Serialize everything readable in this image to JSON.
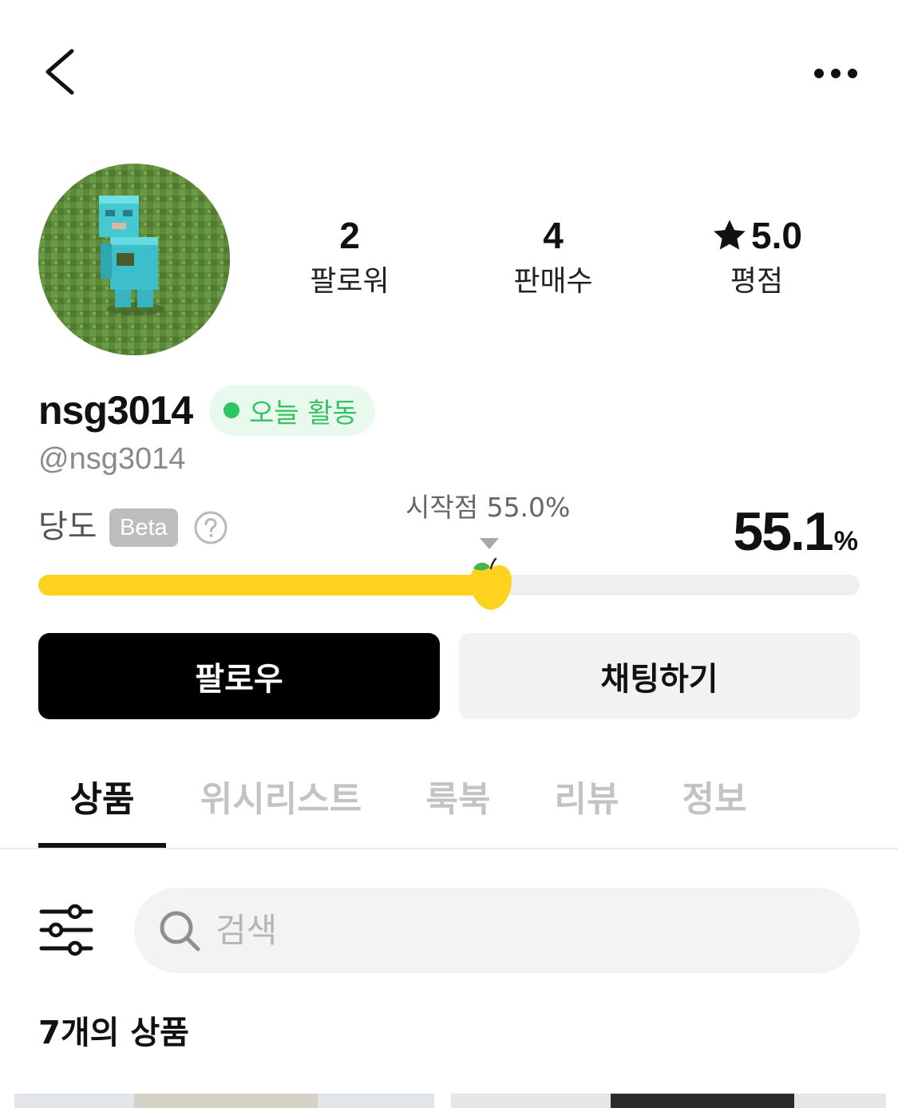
{
  "header": {
    "back_icon": "chevron-left-icon",
    "more_icon": "more-horizontal-icon"
  },
  "profile": {
    "avatar_description": "avatar",
    "stats": [
      {
        "value": "2",
        "label": "팔로워"
      },
      {
        "value": "4",
        "label": "판매수"
      },
      {
        "value": "5.0",
        "label": "평점",
        "icon": "star-icon"
      }
    ],
    "username": "nsg3014",
    "activity_badge": "오늘 활동",
    "handle": "@nsg3014"
  },
  "sugar": {
    "label": "당도",
    "beta": "Beta",
    "help_icon": "question-circle-icon",
    "start_label": "시작점 55.0%",
    "start_value": 55.0,
    "value": "55.1",
    "unit": "%",
    "progress": 0.551
  },
  "actions": {
    "follow": "팔로우",
    "chat": "채팅하기"
  },
  "tabs": [
    {
      "label": "상품",
      "active": true
    },
    {
      "label": "위시리스트",
      "active": false
    },
    {
      "label": "룩북",
      "active": false
    },
    {
      "label": "리뷰",
      "active": false
    },
    {
      "label": "정보",
      "active": false
    }
  ],
  "search": {
    "placeholder": "검색",
    "value": ""
  },
  "products": {
    "count_label": "7개의 상품"
  },
  "colors": {
    "progress_fill": "#ffd21f",
    "activity_green": "#2fc65f",
    "track": "#efefef"
  }
}
